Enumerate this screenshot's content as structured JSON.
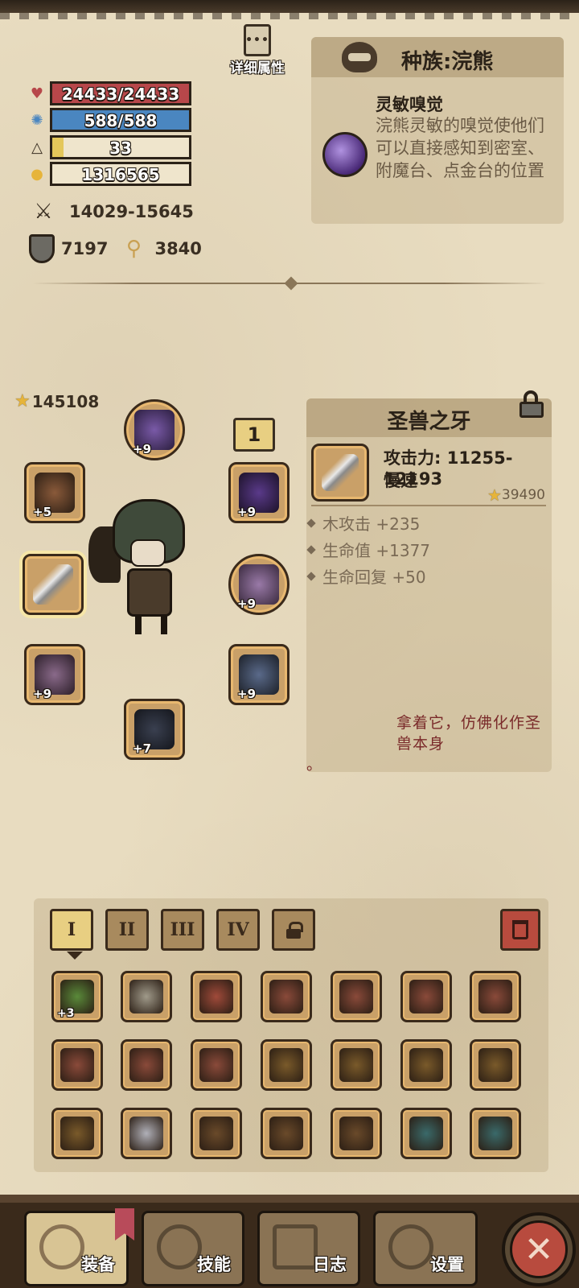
{
  "header": {
    "details_label": "详细属性",
    "details_icon": "dots-icon"
  },
  "stats": {
    "hp": "24433/24433",
    "mp": "588/588",
    "level": "33",
    "level_progress": 0.08,
    "gold": "1316565",
    "attack": "14029-15645",
    "defense": "7197",
    "magic": "3840"
  },
  "race": {
    "title": "种族:浣熊",
    "trait_name": "灵敏嗅觉",
    "trait_desc": "浣熊灵敏的嗅觉使他们可以直接感知到密室、附魔台、点金台的位置"
  },
  "equipment": {
    "total_power": "145108",
    "level_box": "1",
    "slots": [
      {
        "name": "helmet",
        "plus": "+9",
        "color": "#4a3b6e"
      },
      {
        "name": "shoulder",
        "plus": "+9",
        "color": "#3a2a5a"
      },
      {
        "name": "ring-left",
        "plus": "+5",
        "color": "#5a3a2a"
      },
      {
        "name": "weapon",
        "plus": "",
        "color": "#6a6a6a"
      },
      {
        "name": "amulet",
        "plus": "+9",
        "color": "#6a4a6a"
      },
      {
        "name": "gauntlet",
        "plus": "+9",
        "color": "#5a4a6a"
      },
      {
        "name": "armor",
        "plus": "+9",
        "color": "#3a4a5a"
      },
      {
        "name": "boots",
        "plus": "+7",
        "color": "#2a3040"
      }
    ]
  },
  "item": {
    "name": "圣兽之牙",
    "attack": "攻击力: 11255-12193",
    "speed": "慢速",
    "power": "39490",
    "attrs": [
      "木攻击 +235",
      "生命值 +1377",
      "生命回复 +50"
    ],
    "lore": "拿着它，仿佛化作圣兽本身",
    "lore_end": "。"
  },
  "inventory": {
    "tabs": [
      "I",
      "II",
      "III",
      "IV"
    ],
    "items": [
      {
        "plus": "+3",
        "color": "#5a8a3a"
      },
      {
        "plus": "",
        "color": "#a09a8a"
      },
      {
        "plus": "",
        "color": "#a04a3a"
      },
      {
        "plus": "",
        "color": "#8a4a3a"
      },
      {
        "plus": "",
        "color": "#8a4a3a"
      },
      {
        "plus": "",
        "color": "#8a4a3a"
      },
      {
        "plus": "",
        "color": "#8a4a3a"
      },
      {
        "plus": "",
        "color": "#8a4a3a"
      },
      {
        "plus": "",
        "color": "#8a4a3a"
      },
      {
        "plus": "",
        "color": "#8a4a3a"
      },
      {
        "plus": "",
        "color": "#7a5a2a"
      },
      {
        "plus": "",
        "color": "#7a5a2a"
      },
      {
        "plus": "",
        "color": "#7a5a2a"
      },
      {
        "plus": "",
        "color": "#7a5a2a"
      },
      {
        "plus": "",
        "color": "#7a5a2a"
      },
      {
        "plus": "",
        "color": "#b0b0b8"
      },
      {
        "plus": "",
        "color": "#6a4a2a"
      },
      {
        "plus": "",
        "color": "#6a4a2a"
      },
      {
        "plus": "",
        "color": "#6a4a2a"
      },
      {
        "plus": "",
        "color": "#3a6a6a"
      },
      {
        "plus": "",
        "color": "#3a6a6a"
      }
    ]
  },
  "nav": {
    "equip": "装备",
    "skills": "技能",
    "log": "日志",
    "settings": "设置",
    "close_glyph": "✕"
  }
}
